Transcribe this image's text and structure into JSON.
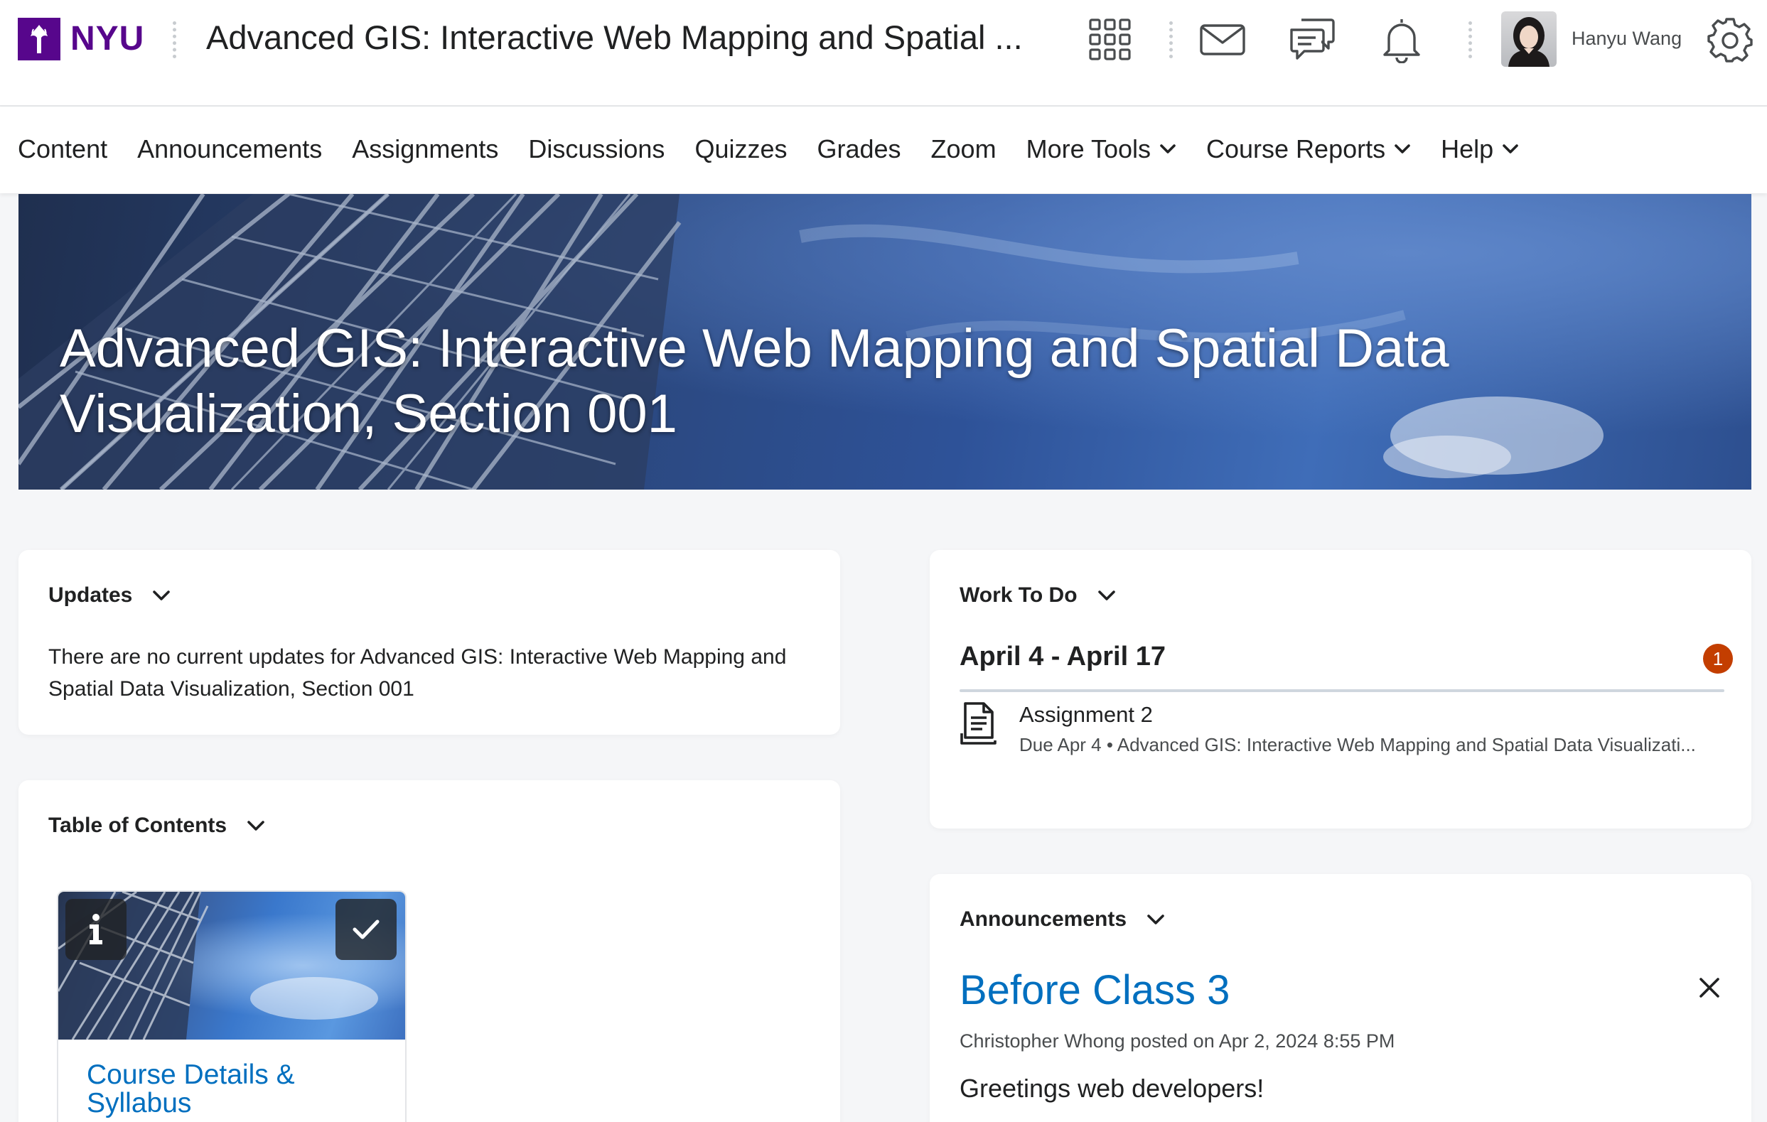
{
  "header": {
    "logo_text": "NYU",
    "course_title": "Advanced GIS: Interactive Web Mapping and Spatial ...",
    "user_name": "Hanyu Wang",
    "icons": [
      "waffle-icon",
      "mail-icon",
      "chat-icon",
      "bell-icon",
      "gear-icon"
    ]
  },
  "nav": {
    "items": [
      {
        "label": "Content"
      },
      {
        "label": "Announcements"
      },
      {
        "label": "Assignments"
      },
      {
        "label": "Discussions"
      },
      {
        "label": "Quizzes"
      },
      {
        "label": "Grades"
      },
      {
        "label": "Zoom"
      },
      {
        "label": "More Tools"
      },
      {
        "label": "Course Reports"
      },
      {
        "label": "Help"
      }
    ]
  },
  "banner": {
    "title": "Advanced GIS: Interactive Web Mapping and Spatial Data Visualization, Section 001"
  },
  "updates": {
    "heading": "Updates",
    "text": "There are no current updates for Advanced GIS: Interactive Web Mapping and Spatial Data Visualization, Section 001"
  },
  "work_to_do": {
    "heading": "Work To Do",
    "week": "April 4 - April 17",
    "badge_count": "1",
    "item_title": "Assignment 2",
    "item_meta": "Due Apr 4 •  Advanced GIS: Interactive Web Mapping and Spatial Data Visualizati..."
  },
  "toc": {
    "heading": "Table of Contents",
    "tile_label": "Course Details & Syllabus"
  },
  "announcements": {
    "heading": "Announcements",
    "title": "Before Class 3",
    "meta": "Christopher Whong posted on Apr 2, 2024 8:55 PM",
    "body": "Greetings web developers!"
  },
  "colors": {
    "brand": "#57068c",
    "link": "#006fbf",
    "badge": "#c33e00"
  }
}
